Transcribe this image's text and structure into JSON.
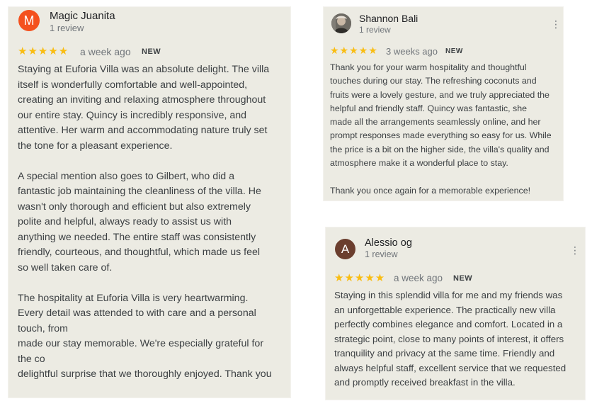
{
  "reviews": [
    {
      "avatar_letter": "M",
      "name": "Magic Juanita",
      "count": "1 review",
      "stars": "★★★★★",
      "time": "a week ago",
      "badge": "NEW",
      "text": "Staying at Euforia Villa was an absolute delight. The villa\nitself is wonderfully comfortable and well-appointed,\ncreating an inviting and relaxing atmosphere throughout\nour entire stay. Quincy is incredibly responsive, and\nattentive. Her warm and accommodating nature truly set\nthe tone for a pleasant experience.\n\nA special mention also goes to Gilbert, who did a\nfantastic job maintaining the cleanliness of the villa. He\nwasn't only thorough and efficient but also extremely\npolite and helpful, always ready to assist us with\nanything we needed. The entire staff was consistently\nfriendly, courteous, and thoughtful, which made us feel\nso well taken care of.\n\nThe hospitality at Euforia Villa is very heartwarming.\nEvery detail was attended to with care and a personal\ntouch, from\nmade our stay memorable. We're especially grateful for\nthe co\ndelightful surprise that we thoroughly enjoyed. Thank you"
    },
    {
      "name": "Shannon Bali",
      "count": "1 review",
      "stars": "★★★★★",
      "time": "3 weeks ago",
      "badge": "NEW",
      "menu": "⋮",
      "text": "Thank you for your warm hospitality and thoughtful\ntouches during our stay. The refreshing coconuts and\nfruits were a lovely gesture, and we truly appreciated the\nhelpful and friendly staff. Quincy was fantastic, she\nmade all the arrangements seamlessly online, and her\nprompt responses made everything so easy for us. While\nthe price is a bit on the higher side, the villa's quality and\natmosphere make it a wonderful place to stay.\n\nThank you once again for a memorable experience!"
    },
    {
      "avatar_letter": "A",
      "name": "Alessio og",
      "count": "1 review",
      "stars": "★★★★★",
      "time": "a week ago",
      "badge": "NEW",
      "menu": "⋮",
      "text": "Staying in this splendid villa for me and my friends was\nan unforgettable experience. The practically new villa\nperfectly combines elegance and comfort. Located in a\nstrategic point, close to many points of interest, it offers\ntranquility and privacy at the same time. Friendly and\nalways helpful staff, excellent service that we requested\nand promptly received breakfast in the villa."
    }
  ]
}
